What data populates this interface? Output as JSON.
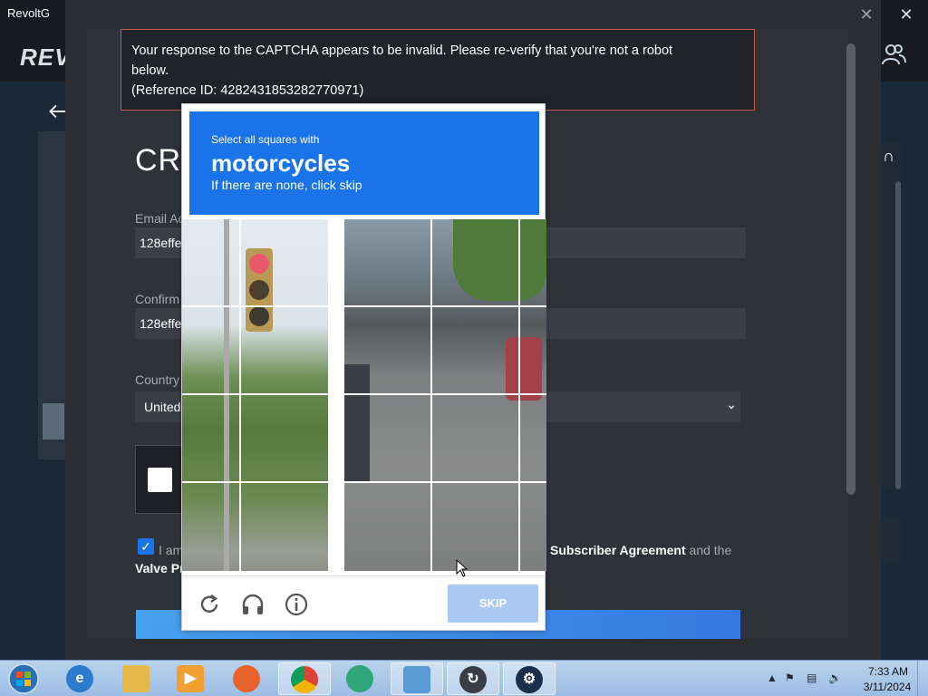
{
  "window": {
    "title": "RevoltG",
    "close_glyph": "✕",
    "logo_text": "REV"
  },
  "dialog": {
    "close_glyph": "✕",
    "error": {
      "line1": "Your response to the CAPTCHA appears to be invalid. Please re-verify that you're not a robot",
      "line2": "below.",
      "line3": "(Reference ID: 4282431853282770971)"
    },
    "form": {
      "title": "CRI",
      "email_label": "Email Ac",
      "email_value": "128effe",
      "confirm_label": "Confirm",
      "confirm_value": "128effe",
      "country_label": "Country",
      "country_value": "United",
      "agree_prefix": "I am",
      "agree_line2": "Valve Pr",
      "agree_link": "Subscriber Agreement",
      "agree_suffix": "and the"
    }
  },
  "captcha": {
    "instruction_small": "Select all squares with",
    "target": "motorcycles",
    "hint": "If there are none, click skip",
    "skip_label": "SKIP",
    "icons": [
      "reload-icon",
      "audio-icon",
      "info-icon"
    ],
    "accent_color": "#1a73e8"
  },
  "taskbar": {
    "apps": [
      "internet-explorer",
      "file-explorer",
      "media-player",
      "firefox",
      "chrome",
      "messenger",
      "control-panel",
      "revolt-app",
      "steam"
    ],
    "clock_time": "7:33 AM",
    "clock_date": "3/11/2024"
  }
}
